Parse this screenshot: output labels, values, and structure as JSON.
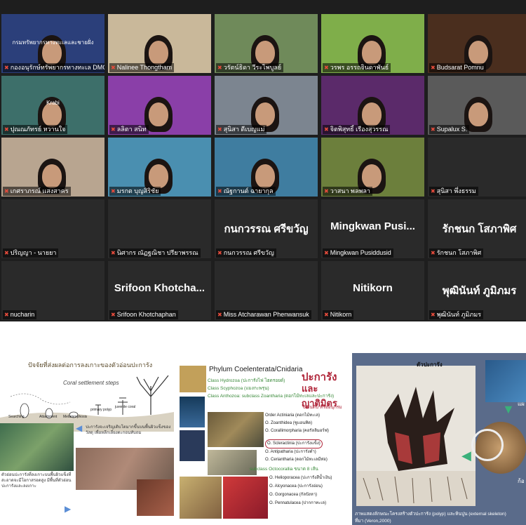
{
  "participants": [
    {
      "name": "กองอนุรักษ์ทรัพยากรทางทะเล DMCR",
      "screen_text": "กรมทรัพยากรทางทะเลและชายฝั่ง",
      "active": true,
      "bg": "#2b3f7a"
    },
    {
      "name": "Nalinee Thongtham",
      "bg": "#c9b89a"
    },
    {
      "name": "วรัตน์ธิดา วีระไพบูลย์",
      "bg": "#6f8a5a"
    },
    {
      "name": "วรพร อรรถจินดาพันธ์",
      "bg": "#7fae4a"
    },
    {
      "name": "Budsarat Pomnu",
      "bg": "#4a2e1e"
    },
    {
      "name": "ปุณณภัทรย์ หวานใจ",
      "bg": "#3d6f6a",
      "screen_text": "Krabi"
    },
    {
      "name": "ลลิตา สนิท",
      "bg": "#8a3fa8"
    },
    {
      "name": "สุนิสา ดีเบญแม่",
      "bg": "#7c8590"
    },
    {
      "name": "จิตพิสุทธิ์ เรืองสุวรรณ",
      "bg": "#5b2a6a"
    },
    {
      "name": "Supalux S.",
      "bg": "#5a5a5a"
    },
    {
      "name": "เกศราภรณ์ แสงสาคร",
      "bg": "#b8a590"
    },
    {
      "name": "มรกต บุญสิริชัย",
      "bg": "#4a8fb0"
    },
    {
      "name": "ณัฐกานต์ ฉายากุล",
      "bg": "#3f7da0"
    },
    {
      "name": "วาสนา พลพลา",
      "bg": "#6c7f3c"
    },
    {
      "name": "สุนิสา พึ่งธรรม",
      "bg": "#2a2a2a"
    },
    {
      "name": "ปริญญา - นายยา",
      "bg": "#2a2a2a"
    },
    {
      "name": "นิศากร ณัฏฐณิชา ปรียาพรรณ",
      "bg": "#2a2a2a"
    },
    {
      "name": "กนกวรรณ ศรีขวัญ",
      "big": "กนกวรรณ ศรีขวัญ",
      "bg": "#2a2a2a"
    },
    {
      "name": "Mingkwan Pusiddusid",
      "big": "Mingkwan Pusi...",
      "bg": "#2a2a2a"
    },
    {
      "name": "รักชนก โสภาพิศ",
      "big": "รักชนก โสภาพิศ",
      "bg": "#2a2a2a"
    },
    {
      "name": "nucharin",
      "bg": "#2a2a2a"
    },
    {
      "name": "Srifoon Khotchaphan",
      "big": "Srifoon Khotcha...",
      "bg": "#2a2a2a"
    },
    {
      "name": "Miss Atcharawan Phenwansuk",
      "bg": "#2a2a2a"
    },
    {
      "name": "Nitikorn",
      "big": "Nitikorn",
      "bg": "#2a2a2a"
    },
    {
      "name": "พุฒินันท์ ภูมิภมร",
      "big": "พุฒินันท์ ภูมิภมร",
      "bg": "#2a2a2a"
    }
  ],
  "slide1": {
    "title": "ปัจจัยที่ส่งผลต่อการลงเกาะของตัวอ่อนปะการัง",
    "diagram_steps": "Coral settlement steps",
    "stages": [
      "Searching",
      "Attachment",
      "Metamorphosis",
      "primary polyp",
      "juvenile coral"
    ],
    "note1": "ปะการังจะเจริญเติบโตมากขึ้นบนพื้นผิวแข็งของวัสดุ เพื่อหลีกเลี่ยงตะกอนทับถม",
    "note2": "ตัวอ่อนปะการังที่ลงเกาะบนพื้นผิวแข็งที่สะอาดจะมีโอกาสรอดสูง มีพื้นที่ตัวอ่อนปะการังและลงเกาะ"
  },
  "slide2": {
    "phylum": "Phylum Coelenterata/Cnidaria",
    "heading1": "ปะการัง",
    "heading2": "และญาติมิตร",
    "classes": [
      "Class Hydrozoa (ปะการังไฟ ไฮดรอยด์)",
      "Class Scyphozoa (แมงกะพรุน)",
      "Class Anthozoa: subclass Zoantharia (ดอกไม้ทะเลและปะการัง)"
    ],
    "count1": "6 อันดับ หรืออนุกรม",
    "orders": [
      "Order Actiniaria (ดอกไม้ทะเล)",
      "O. Zoanthidea (ซูแอนทิด)",
      "O. Corallimorpharia (คอรัลลิมอร์ฟ)",
      "O. Scleractinia (ปะการังแข็ง)",
      "O. Antipatharia (ปะการังดำ)",
      "O. Ceriantharia (ดอกไม้ทะเลมีท่อ)"
    ],
    "subclass2": "subclass Octocorallia ขนาด 8 เส้น",
    "orders2": [
      "O. Helioporacea (ปะการังสีน้ำเงิน)",
      "O. Alcyonacea (ปะการังอ่อน)",
      "O. Gorgonacea (กัลปังหา)",
      "O. Pennatulacea (ปากกาทะเล)"
    ]
  },
  "slide3": {
    "top_label": "ตัวปะการัง",
    "right_label1": "แผ",
    "right_label2": "ก้อ",
    "caption": "ภาพแสดงลักษณะโครงสร้างตัวปะการัง (polyp) และหินปูน (external skeleton)",
    "source": "ที่มา (Veron,2000)"
  }
}
